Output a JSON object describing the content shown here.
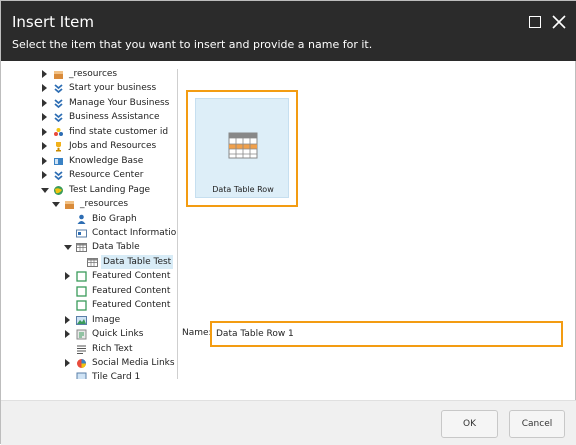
{
  "dialog": {
    "title": "Insert Item",
    "subtitle": "Select the item that you want to insert and provide a name for it."
  },
  "tree": {
    "items": [
      {
        "label": "_resources",
        "icon": "package-icon",
        "arrow": "right"
      },
      {
        "label": "Start your business",
        "icon": "chevrons-down-icon",
        "arrow": "right"
      },
      {
        "label": "Manage Your Business",
        "icon": "chevrons-down-icon",
        "arrow": "right"
      },
      {
        "label": "Business Assistance",
        "icon": "chevrons-down-icon",
        "arrow": "right"
      },
      {
        "label": "find state customer id",
        "icon": "dots-icon",
        "arrow": "right"
      },
      {
        "label": "Jobs and Resources",
        "icon": "trophy-icon",
        "arrow": "right"
      },
      {
        "label": "Knowledge Base",
        "icon": "book-icon",
        "arrow": "right"
      },
      {
        "label": "Resource Center",
        "icon": "chevrons-down-icon",
        "arrow": "right"
      },
      {
        "label": "Test Landing Page",
        "icon": "globe-icon",
        "arrow": "down"
      },
      {
        "label": "_resources",
        "icon": "package-icon",
        "arrow": "down"
      },
      {
        "label": "Bio Graph",
        "icon": "person-icon",
        "arrow": ""
      },
      {
        "label": "Contact Information",
        "icon": "contact-card-icon",
        "arrow": ""
      },
      {
        "label": "Data Table",
        "icon": "table-icon",
        "arrow": "down"
      },
      {
        "label": "Data Table Test",
        "icon": "table-icon",
        "arrow": ""
      },
      {
        "label": "Featured Content",
        "icon": "square-outline-icon",
        "arrow": "right"
      },
      {
        "label": "Featured Content",
        "icon": "square-outline-icon",
        "arrow": ""
      },
      {
        "label": "Featured Content",
        "icon": "square-outline-icon",
        "arrow": ""
      },
      {
        "label": "Image",
        "icon": "image-icon",
        "arrow": "right"
      },
      {
        "label": "Quick Links",
        "icon": "links-icon",
        "arrow": "right"
      },
      {
        "label": "Rich Text",
        "icon": "rich-text-icon",
        "arrow": ""
      },
      {
        "label": "Social Media Links",
        "icon": "social-icon",
        "arrow": "right"
      },
      {
        "label": "Tile Card 1",
        "icon": "tile-icon",
        "arrow": ""
      }
    ],
    "selected_index": 13
  },
  "template_tile": {
    "label": "Data Table Row",
    "icon": "table-icon"
  },
  "name_field": {
    "label": "Name:",
    "value": "Data Table Row 1"
  },
  "footer": {
    "ok_label": "OK",
    "cancel_label": "Cancel"
  },
  "colors": {
    "title_bar": "#2b2b2b",
    "highlight": "#f39c12",
    "selected_bg": "#d8ecf7"
  }
}
